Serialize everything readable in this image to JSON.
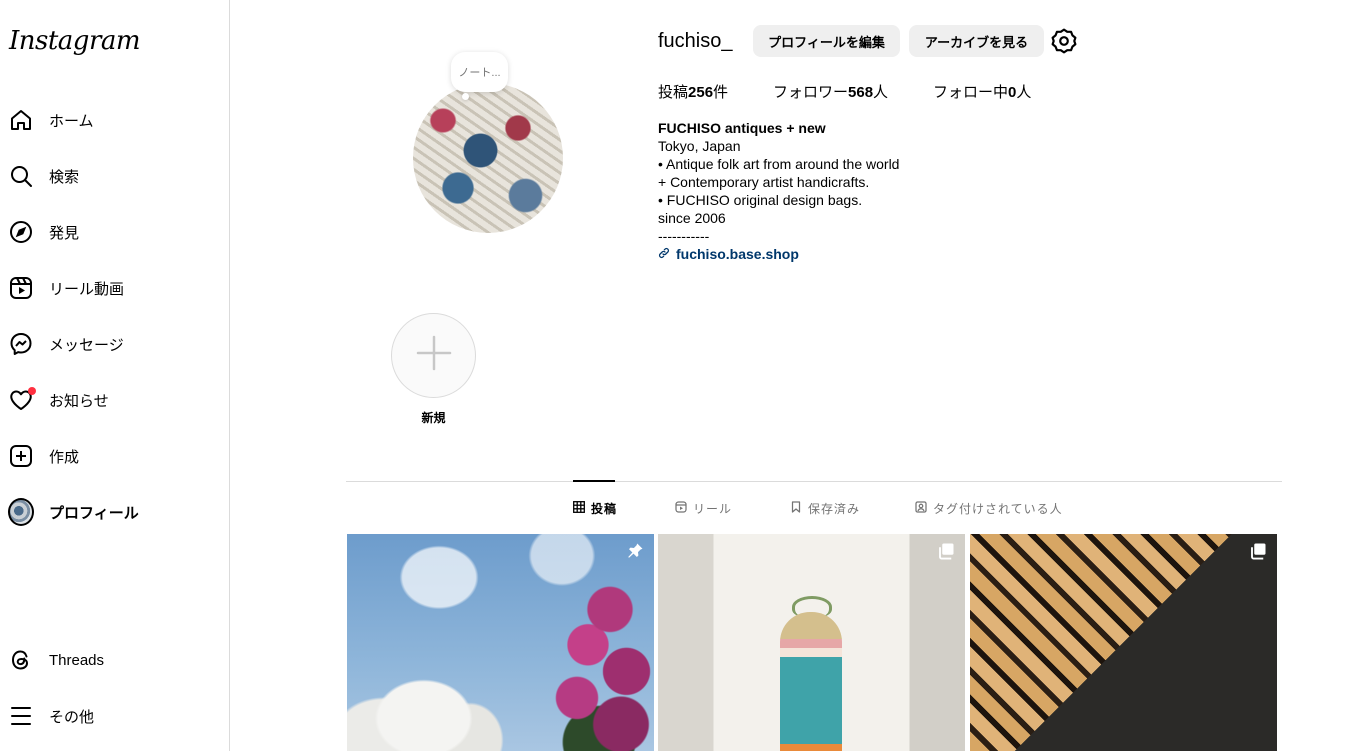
{
  "sidebar": {
    "logo": "Instagram",
    "items": [
      {
        "label": "ホーム"
      },
      {
        "label": "検索"
      },
      {
        "label": "発見"
      },
      {
        "label": "リール動画"
      },
      {
        "label": "メッセージ"
      },
      {
        "label": "お知らせ"
      },
      {
        "label": "作成"
      },
      {
        "label": "プロフィール"
      }
    ],
    "bottom": [
      {
        "label": "Threads"
      },
      {
        "label": "その他"
      }
    ]
  },
  "profile": {
    "note": "ノート...",
    "username": "fuchiso_",
    "edit_button": "プロフィールを編集",
    "archive_button": "アーカイブを見る",
    "stats": {
      "posts_prefix": "投稿",
      "posts": "256",
      "posts_suffix": "件",
      "followers_prefix": "フォロワー",
      "followers": "568",
      "followers_suffix": "人",
      "following_prefix": "フォロー中",
      "following": "0",
      "following_suffix": "人"
    },
    "bio": {
      "name": "FUCHISO antiques + new",
      "lines": [
        "Tokyo, Japan",
        "• Antique folk art from around the world",
        "+ Contemporary artist handicrafts.",
        "• FUCHISO original design bags.",
        "since 2006",
        "-----------"
      ],
      "link": "fuchiso.base.shop"
    }
  },
  "highlights": {
    "new_label": "新規"
  },
  "tabs": [
    {
      "label": "投稿"
    },
    {
      "label": "リール"
    },
    {
      "label": "保存済み"
    },
    {
      "label": "タグ付けされている人"
    }
  ]
}
